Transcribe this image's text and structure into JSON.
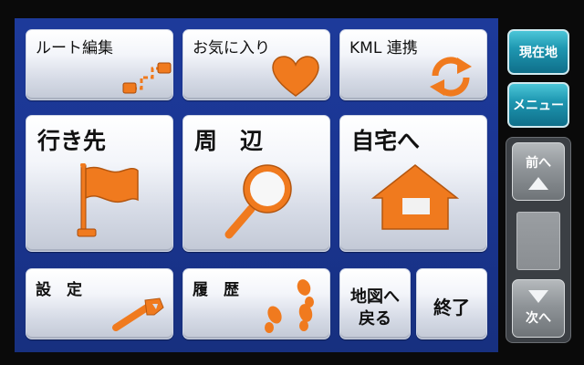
{
  "menu": {
    "route_edit": "ルート編集",
    "favorites": "お気に入り",
    "kml_link": "KML 連携",
    "destination": "行き先",
    "nearby": "周　辺",
    "home": "自宅へ",
    "settings": "設　定",
    "history": "履　歴",
    "to_map_line1": "地図へ",
    "to_map_line2": "戻る",
    "end": "終了"
  },
  "side": {
    "current_location": "現在地",
    "menu": "メニュー",
    "prev_page": "前へ",
    "next_page": "次へ"
  },
  "icons": {
    "route_edit": "route-edit-icon",
    "favorites": "heart-icon",
    "kml_link": "sync-arrows-icon",
    "destination": "flag-icon",
    "nearby": "magnifier-icon",
    "home": "house-icon",
    "settings": "wrench-icon",
    "history": "footprints-icon",
    "scroll_up": "arrow-up-icon",
    "scroll_down": "arrow-down-icon"
  },
  "colors": {
    "icon_orange": "#f07a1e",
    "panel_blue": "#1b3795",
    "side_teal": "#1f98b2"
  }
}
